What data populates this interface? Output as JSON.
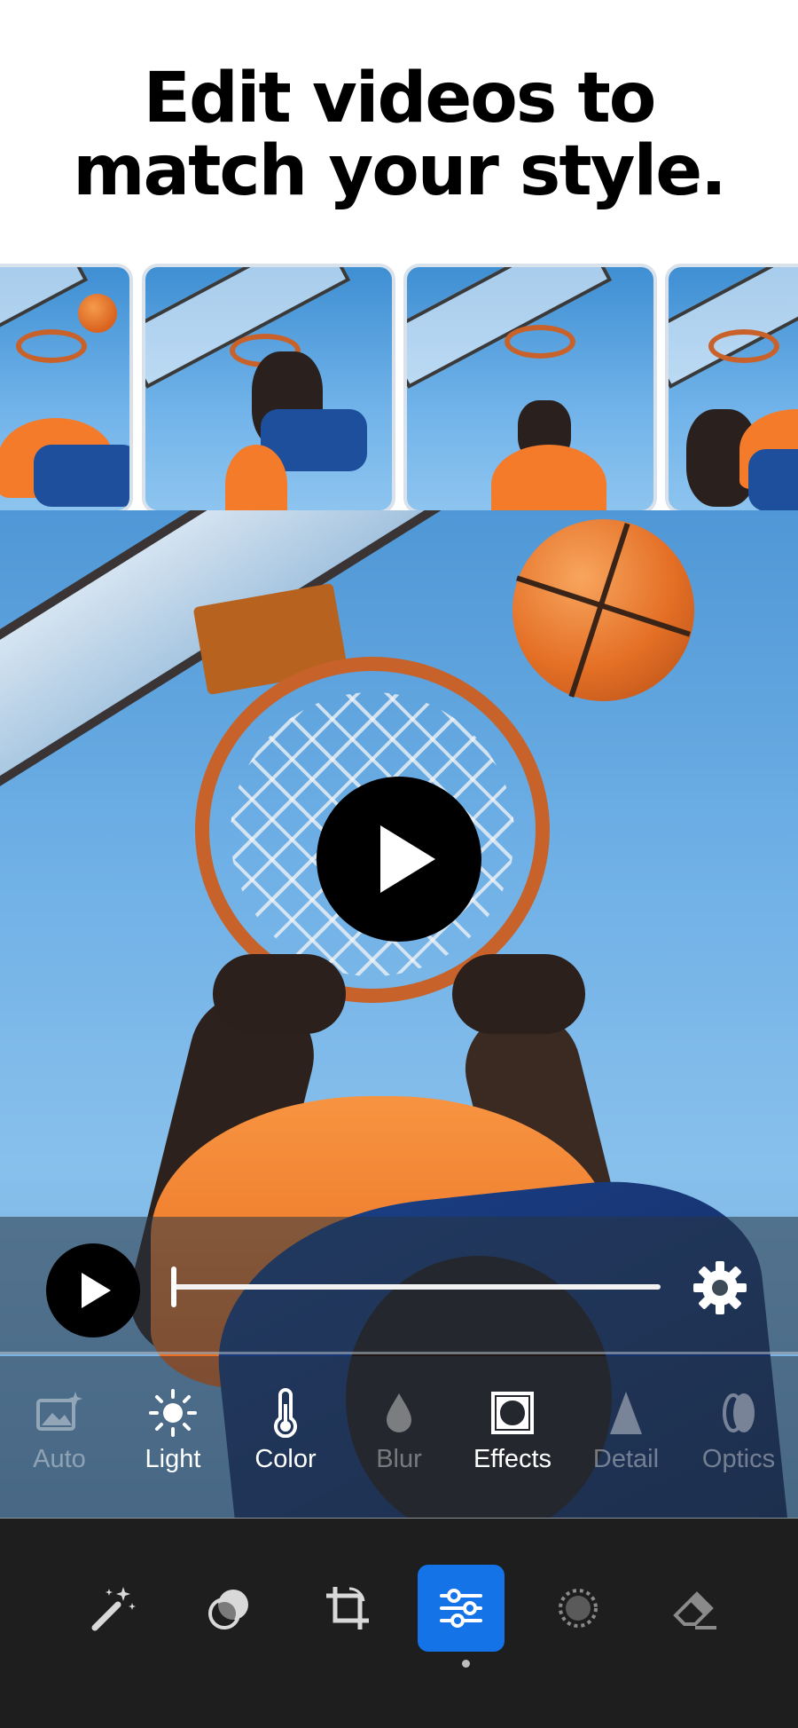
{
  "headline": {
    "line1": "Edit videos to",
    "line2": "match your style."
  },
  "thumbnails": [
    {
      "name": "clip-1"
    },
    {
      "name": "clip-2"
    },
    {
      "name": "clip-3"
    },
    {
      "name": "clip-4"
    }
  ],
  "player": {
    "progress": 0,
    "play_icon": "play-icon",
    "settings_icon": "gear-icon"
  },
  "categories": [
    {
      "label": "Auto",
      "icon": "image-sparkle-icon",
      "enabled": false
    },
    {
      "label": "Light",
      "icon": "sun-icon",
      "enabled": true
    },
    {
      "label": "Color",
      "icon": "thermometer-icon",
      "enabled": true
    },
    {
      "label": "Blur",
      "icon": "droplet-icon",
      "enabled": false
    },
    {
      "label": "Effects",
      "icon": "vignette-icon",
      "enabled": true
    },
    {
      "label": "Detail",
      "icon": "triangle-icon",
      "enabled": false
    },
    {
      "label": "Optics",
      "icon": "lens-icon",
      "enabled": false
    }
  ],
  "toolbar": {
    "items": [
      {
        "icon": "magic-wand-icon"
      },
      {
        "icon": "heal-icon"
      },
      {
        "icon": "crop-icon"
      },
      {
        "icon": "adjust-sliders-icon",
        "active": true
      },
      {
        "icon": "selective-icon"
      },
      {
        "icon": "eraser-icon"
      }
    ]
  },
  "colors": {
    "accent": "#1473e6",
    "toolbar_bg": "#1e1e1e",
    "jersey": "#f47b2a"
  }
}
